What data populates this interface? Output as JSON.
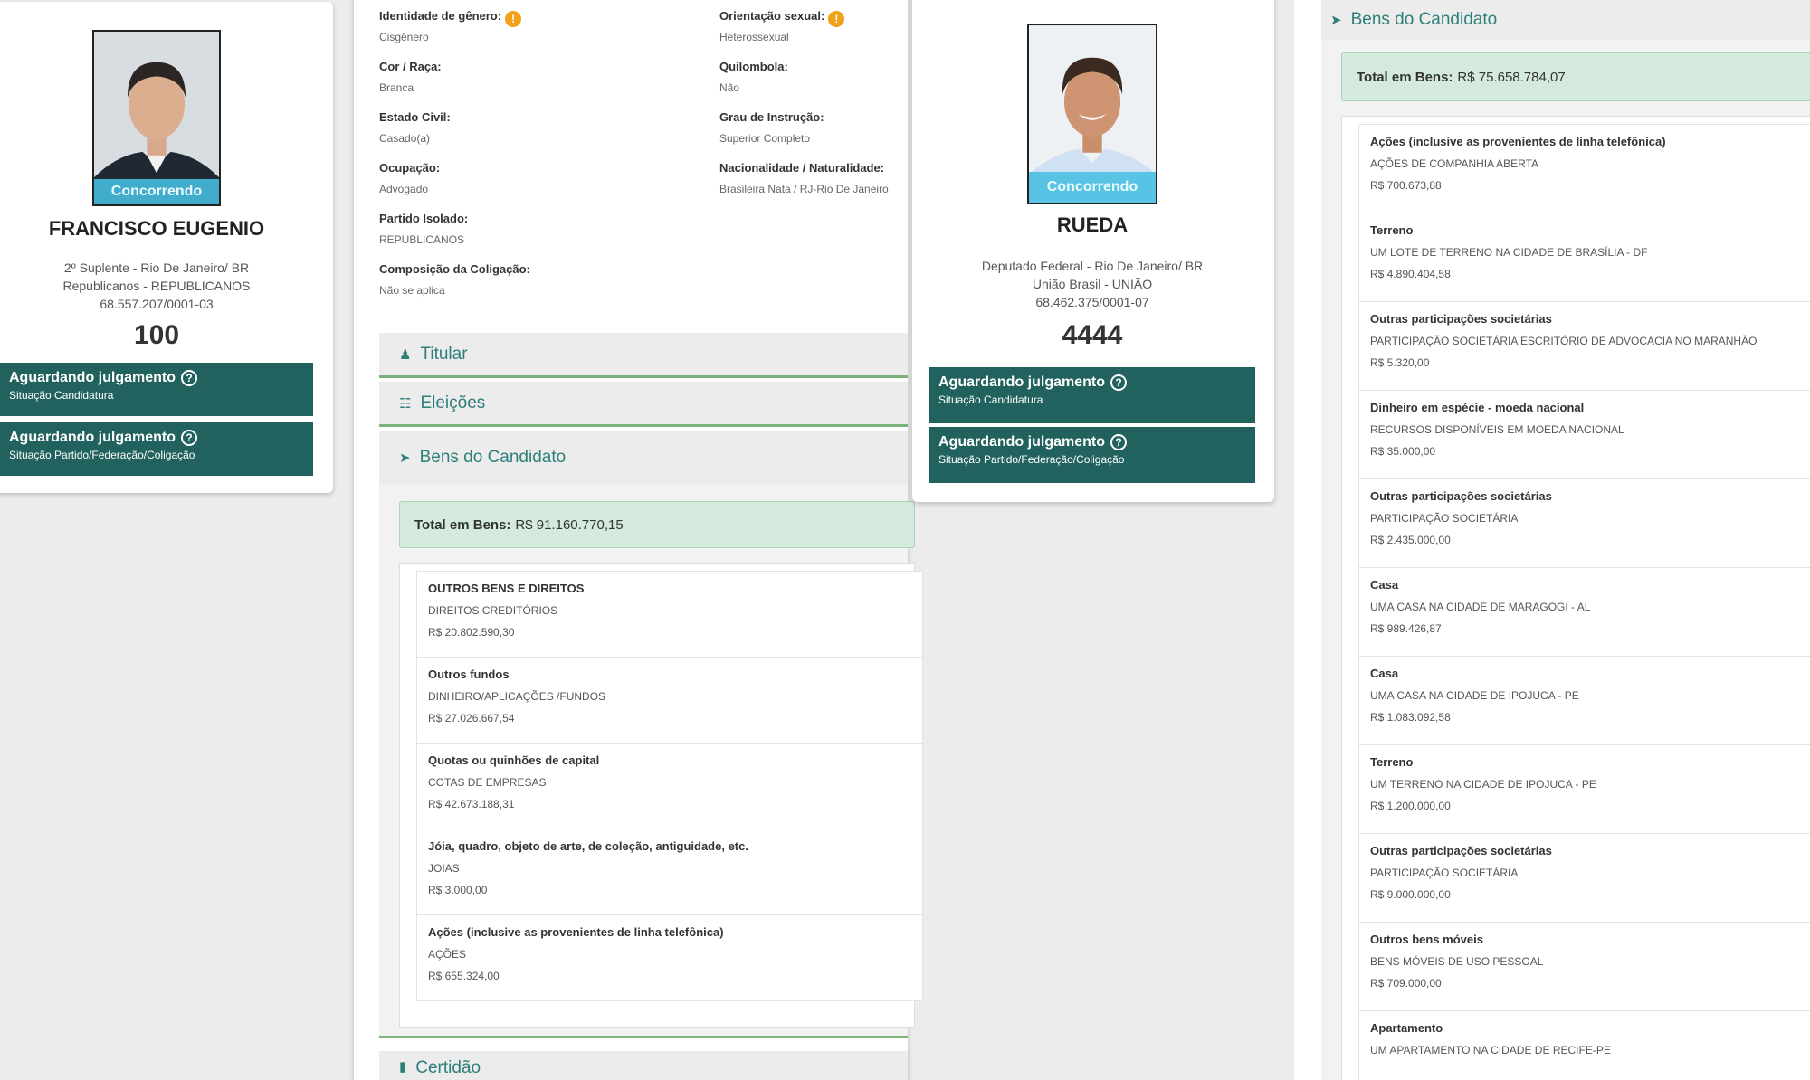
{
  "candidate1": {
    "photo_status": "Concorrendo",
    "name": "FRANCISCO EUGENIO",
    "role": "2º Suplente - Rio De Janeiro/ BR",
    "party": "Republicanos - REPUBLICANOS",
    "cnpj": "68.557.207/0001-03",
    "number": "100",
    "status_boxes": [
      {
        "title": "Aguardando julgamento",
        "subtitle": "Situação Candidatura"
      },
      {
        "title": "Aguardando julgamento",
        "subtitle": "Situação Partido/Federação/Coligação"
      }
    ]
  },
  "details": {
    "fields_left": [
      {
        "label": "Identidade de gênero:",
        "value": "Cisgênero",
        "warn": true
      },
      {
        "label": "Cor / Raça:",
        "value": "Branca"
      },
      {
        "label": "Estado Civil:",
        "value": "Casado(a)"
      },
      {
        "label": "Ocupação:",
        "value": "Advogado"
      },
      {
        "label": "Partido Isolado:",
        "value": "REPUBLICANOS"
      },
      {
        "label": "Composição da Coligação:",
        "value": "Não se aplica"
      }
    ],
    "fields_right": [
      {
        "label": "Orientação sexual:",
        "value": "Heterossexual",
        "warn": true
      },
      {
        "label": "Quilombola:",
        "value": "Não"
      },
      {
        "label": "Grau de Instrução:",
        "value": "Superior Completo"
      },
      {
        "label": "Nacionalidade / Naturalidade:",
        "value": "Brasileira Nata / RJ-Rio De Janeiro"
      }
    ],
    "accordion": {
      "titular": "Titular",
      "eleicoes": "Eleições",
      "bens": "Bens do Candidato",
      "certidao": "Certidão"
    },
    "total_label": "Total em Bens:",
    "total_value": "R$ 91.160.770,15",
    "assets": [
      {
        "title": "OUTROS BENS E DIREITOS",
        "desc": "DIREITOS CREDITÓRIOS",
        "value": "R$ 20.802.590,30"
      },
      {
        "title": "Outros fundos",
        "desc": "DINHEIRO/APLICAÇÕES /FUNDOS",
        "value": "R$ 27.026.667,54"
      },
      {
        "title": "Quotas ou quinhões de capital",
        "desc": "COTAS DE EMPRESAS",
        "value": "R$ 42.673.188,31"
      },
      {
        "title": "Jóia, quadro, objeto de arte, de coleção, antiguidade, etc.",
        "desc": "JOIAS",
        "value": "R$ 3.000,00"
      },
      {
        "title": "Ações (inclusive as provenientes de linha telefônica)",
        "desc": "AÇÕES",
        "value": "R$ 655.324,00"
      }
    ]
  },
  "candidate2": {
    "photo_status": "Concorrendo",
    "name": "RUEDA",
    "role": "Deputado Federal - Rio De Janeiro/ BR",
    "party": "União Brasil - UNIÃO",
    "cnpj": "68.462.375/0001-07",
    "number": "4444",
    "status_boxes": [
      {
        "title": "Aguardando julgamento",
        "subtitle": "Situação Candidatura"
      },
      {
        "title": "Aguardando julgamento",
        "subtitle": "Situação Partido/Federação/Coligação"
      }
    ]
  },
  "bens2": {
    "header": "Bens do Candidato",
    "total_label": "Total em Bens:",
    "total_value": "R$ 75.658.784,07",
    "assets": [
      {
        "title": "Ações (inclusive as provenientes de linha telefônica)",
        "desc": "AÇÕES DE COMPANHIA ABERTA",
        "value": "R$ 700.673,88"
      },
      {
        "title": "Terreno",
        "desc": "UM LOTE DE TERRENO NA CIDADE DE BRASÍLIA - DF",
        "value": "R$ 4.890.404,58"
      },
      {
        "title": "Outras participações societárias",
        "desc": "PARTICIPAÇÃO SOCIETÁRIA ESCRITÓRIO DE ADVOCACIA NO MARANHÃO",
        "value": "R$ 5.320,00"
      },
      {
        "title": "Dinheiro em espécie - moeda nacional",
        "desc": "RECURSOS DISPONÍVEIS EM MOEDA NACIONAL",
        "value": "R$ 35.000,00"
      },
      {
        "title": "Outras participações societárias",
        "desc": "PARTICIPAÇÃO SOCIETÁRIA",
        "value": "R$ 2.435.000,00"
      },
      {
        "title": "Casa",
        "desc": "UMA CASA NA CIDADE DE MARAGOGI - AL",
        "value": "R$ 989.426,87"
      },
      {
        "title": "Casa",
        "desc": "UMA CASA NA CIDADE DE IPOJUCA - PE",
        "value": "R$ 1.083.092,58"
      },
      {
        "title": "Terreno",
        "desc": "UM TERRENO NA CIDADE DE IPOJUCA - PE",
        "value": "R$ 1.200.000,00"
      },
      {
        "title": "Outras participações societárias",
        "desc": "PARTICIPAÇÃO SOCIETÁRIA",
        "value": "R$ 9.000.000,00"
      },
      {
        "title": "Outros bens móveis",
        "desc": "BENS MÓVEIS DE USO PESSOAL",
        "value": "R$ 709.000,00"
      },
      {
        "title": "Apartamento",
        "desc": "UM APARTAMENTO NA CIDADE DE RECIFE-PE",
        "value": ""
      }
    ]
  }
}
